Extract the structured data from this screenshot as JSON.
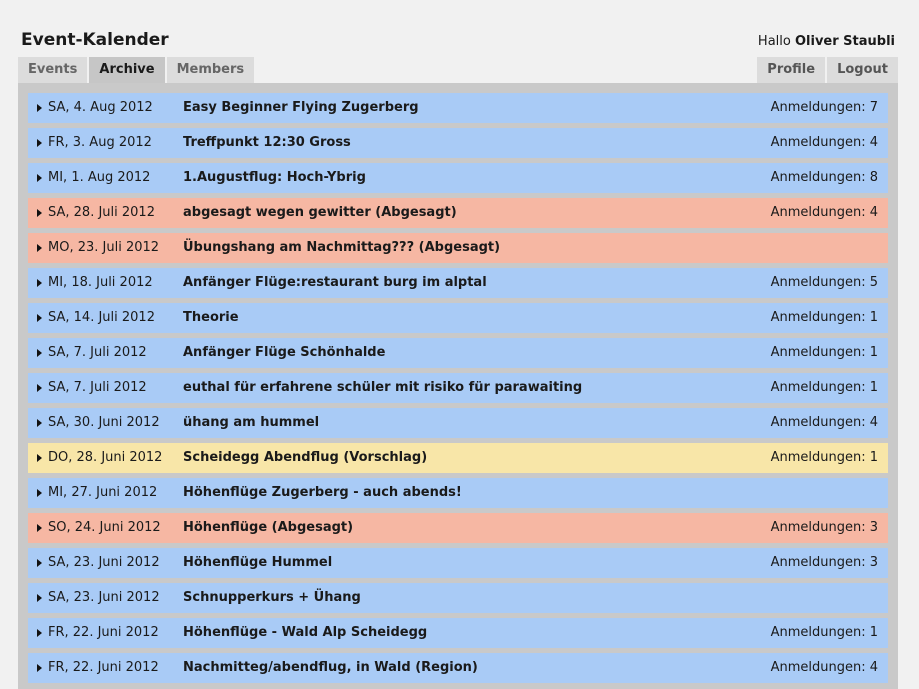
{
  "header": {
    "title": "Event-Kalender",
    "greeting_prefix": "Hallo",
    "user_name": "Oliver Staubli"
  },
  "nav": {
    "tabs": [
      {
        "label": "Events",
        "active": false
      },
      {
        "label": "Archive",
        "active": true
      },
      {
        "label": "Members",
        "active": false
      }
    ],
    "profile_label": "Profile",
    "logout_label": "Logout"
  },
  "colors": {
    "normal": "#a9cbf6",
    "cancelled": "#f6b7a3",
    "proposal": "#f8e6a8",
    "panel": "#c9c9c9",
    "page": "#f1f1f1"
  },
  "events": [
    {
      "date": "SA, 4. Aug 2012",
      "name": "Easy Beginner Flying Zugerberg",
      "registrations": "Anmeldungen: 7",
      "status": "blue"
    },
    {
      "date": "FR, 3. Aug 2012",
      "name": "Treffpunkt 12:30 Gross",
      "registrations": "Anmeldungen: 4",
      "status": "blue"
    },
    {
      "date": "MI, 1. Aug 2012",
      "name": "1.Augustflug: Hoch-Ybrig",
      "registrations": "Anmeldungen: 8",
      "status": "blue"
    },
    {
      "date": "SA, 28. Juli 2012",
      "name": "abgesagt wegen gewitter (Abgesagt)",
      "registrations": "Anmeldungen: 4",
      "status": "red"
    },
    {
      "date": "MO, 23. Juli 2012",
      "name": "Übungshang am Nachmittag??? (Abgesagt)",
      "registrations": "",
      "status": "red"
    },
    {
      "date": "MI, 18. Juli 2012",
      "name": "Anfänger Flüge:restaurant burg im alptal",
      "registrations": "Anmeldungen: 5",
      "status": "blue"
    },
    {
      "date": "SA, 14. Juli 2012",
      "name": "Theorie",
      "registrations": "Anmeldungen: 1",
      "status": "blue"
    },
    {
      "date": "SA, 7. Juli 2012",
      "name": "Anfänger Flüge Schönhalde",
      "registrations": "Anmeldungen: 1",
      "status": "blue"
    },
    {
      "date": "SA, 7. Juli 2012",
      "name": "euthal für erfahrene schüler mit risiko für parawaiting",
      "registrations": "Anmeldungen: 1",
      "status": "blue"
    },
    {
      "date": "SA, 30. Juni 2012",
      "name": "ühang am hummel",
      "registrations": "Anmeldungen: 4",
      "status": "blue"
    },
    {
      "date": "DO, 28. Juni 2012",
      "name": "Scheidegg Abendflug (Vorschlag)",
      "registrations": "Anmeldungen: 1",
      "status": "yellow"
    },
    {
      "date": "MI, 27. Juni 2012",
      "name": "Höhenflüge Zugerberg - auch abends!",
      "registrations": "",
      "status": "blue"
    },
    {
      "date": "SO, 24. Juni 2012",
      "name": "Höhenflüge (Abgesagt)",
      "registrations": "Anmeldungen: 3",
      "status": "red"
    },
    {
      "date": "SA, 23. Juni 2012",
      "name": "Höhenflüge Hummel",
      "registrations": "Anmeldungen: 3",
      "status": "blue"
    },
    {
      "date": "SA, 23. Juni 2012",
      "name": "Schnupperkurs + Ühang",
      "registrations": "",
      "status": "blue"
    },
    {
      "date": "FR, 22. Juni 2012",
      "name": "Höhenflüge - Wald Alp Scheidegg",
      "registrations": "Anmeldungen: 1",
      "status": "blue"
    },
    {
      "date": "FR, 22. Juni 2012",
      "name": "Nachmitteg/abendflug, in Wald (Region)",
      "registrations": "Anmeldungen: 4",
      "status": "blue"
    }
  ]
}
